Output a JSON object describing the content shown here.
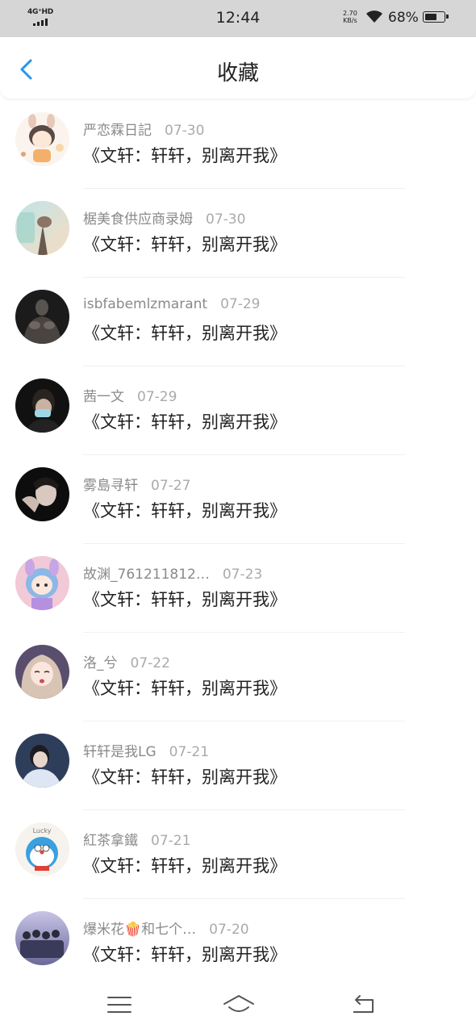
{
  "status_bar": {
    "network": "4G⁺HD",
    "time": "12:44",
    "speed_value": "2.70",
    "speed_unit": "KB/s",
    "battery_percent": "68%",
    "battery_level": 0.68
  },
  "header": {
    "back_icon": "chevron-left-icon",
    "title": "收藏",
    "accent_color": "#2196f3"
  },
  "favorites": [
    {
      "name": "严恋霖日記",
      "date": "07-30",
      "title": "《文轩：轩轩，别离开我》"
    },
    {
      "name": "椐美食供应商录姆",
      "date": "07-30",
      "title": "《文轩：轩轩，别离开我》"
    },
    {
      "name": "isbfabemlzmarant",
      "date": "07-29",
      "title": "《文轩：轩轩，别离开我》"
    },
    {
      "name": "茜一文",
      "date": "07-29",
      "title": "《文轩：轩轩，别离开我》"
    },
    {
      "name": "雾島寻轩",
      "date": "07-27",
      "title": "《文轩：轩轩，别离开我》"
    },
    {
      "name": "故渊_761211812…",
      "date": "07-23",
      "title": "《文轩：轩轩，别离开我》"
    },
    {
      "name": "洛_兮",
      "date": "07-22",
      "title": "《文轩：轩轩，别离开我》"
    },
    {
      "name": "轩轩是我LG",
      "date": "07-21",
      "title": "《文轩：轩轩，别离开我》"
    },
    {
      "name": "紅茶拿鐵",
      "date": "07-21",
      "title": "《文轩：轩轩，别离开我》"
    },
    {
      "name": "爆米花🍿和七个…",
      "date": "07-20",
      "title": "《文轩：轩轩，别离开我》"
    }
  ],
  "avatar_badge_text": "Lucky",
  "nav_bar": {
    "menu_icon": "menu-icon",
    "home_icon": "home-icon",
    "back_icon": "back-icon"
  }
}
